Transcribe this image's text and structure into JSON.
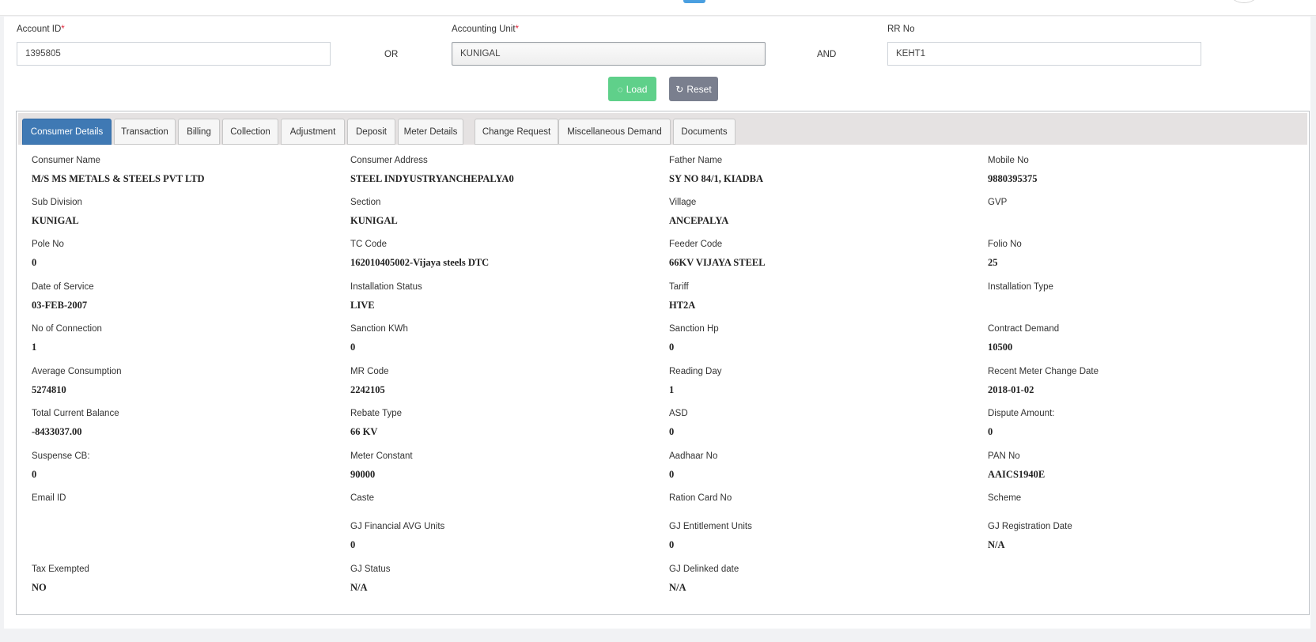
{
  "search": {
    "account_id_label": "Account ID",
    "account_id_value": "1395805",
    "or_label": "OR",
    "accounting_unit_label": "Accounting Unit",
    "accounting_unit_value": "KUNIGAL",
    "and_label": "AND",
    "rr_no_label": "RR No",
    "rr_no_value": "KEHT1",
    "required_mark": "*",
    "load_label": "Load",
    "reset_label": "Reset"
  },
  "tabs": [
    {
      "label": "Consumer Details",
      "active": true
    },
    {
      "label": "Transaction"
    },
    {
      "label": "Billing"
    },
    {
      "label": "Collection"
    },
    {
      "label": "Adjustment"
    },
    {
      "label": "Deposit"
    },
    {
      "label": "Meter Details"
    },
    {
      "label": "Change Request"
    },
    {
      "label": "Miscellaneous Demand"
    },
    {
      "label": "Documents"
    }
  ],
  "details": [
    [
      {
        "label": "Consumer Name",
        "value": "M/S MS METALS & STEELS PVT LTD"
      },
      {
        "label": "Consumer Address",
        "value": "STEEL INDYUSTRYANCHEPALYA0"
      },
      {
        "label": "Father Name",
        "value": "SY NO 84/1, KIADBA"
      },
      {
        "label": "Mobile No",
        "value": "9880395375"
      }
    ],
    [
      {
        "label": "Sub Division",
        "value": "KUNIGAL"
      },
      {
        "label": "Section",
        "value": "KUNIGAL"
      },
      {
        "label": "Village",
        "value": "ANCEPALYA"
      },
      {
        "label": "GVP",
        "value": ""
      }
    ],
    [
      {
        "label": "Pole No",
        "value": "0"
      },
      {
        "label": "TC Code",
        "value": "162010405002-Vijaya steels DTC"
      },
      {
        "label": "Feeder Code",
        "value": "66KV VIJAYA STEEL"
      },
      {
        "label": "Folio No",
        "value": "25"
      }
    ],
    [
      {
        "label": "Date of Service",
        "value": "03-FEB-2007"
      },
      {
        "label": "Installation Status",
        "value": "LIVE"
      },
      {
        "label": "Tariff",
        "value": "HT2A"
      },
      {
        "label": "Installation Type",
        "value": ""
      }
    ],
    [
      {
        "label": "No of Connection",
        "value": "1"
      },
      {
        "label": "Sanction KWh",
        "value": "0"
      },
      {
        "label": "Sanction Hp",
        "value": "0"
      },
      {
        "label": "Contract Demand",
        "value": "10500"
      }
    ],
    [
      {
        "label": "Average Consumption",
        "value": "5274810"
      },
      {
        "label": "MR Code",
        "value": "2242105"
      },
      {
        "label": "Reading Day",
        "value": "1"
      },
      {
        "label": "Recent Meter Change Date",
        "value": "2018-01-02"
      }
    ],
    [
      {
        "label": "Total Current Balance",
        "value": "-8433037.00"
      },
      {
        "label": "Rebate Type",
        "value": "66 KV"
      },
      {
        "label": "ASD",
        "value": "0"
      },
      {
        "label": "Dispute Amount:",
        "value": "0"
      }
    ],
    [
      {
        "label": "Suspense CB:",
        "value": "0"
      },
      {
        "label": "Meter Constant",
        "value": "90000"
      },
      {
        "label": "Aadhaar No",
        "value": "0"
      },
      {
        "label": "PAN No",
        "value": "AAICS1940E"
      }
    ],
    [
      {
        "label": "Email ID",
        "value": ""
      },
      {
        "label": "Caste",
        "value": ""
      },
      {
        "label": "Ration Card No",
        "value": ""
      },
      {
        "label": "Scheme",
        "value": ""
      }
    ],
    [
      null,
      {
        "label": "GJ Financial AVG Units",
        "value": "0"
      },
      {
        "label": "GJ Entitlement Units",
        "value": "0"
      },
      {
        "label": "GJ Registration Date",
        "value": "N/A"
      }
    ],
    [
      {
        "label": "Tax Exempted",
        "value": "NO"
      },
      {
        "label": "GJ Status",
        "value": "N/A"
      },
      {
        "label": "GJ Delinked date",
        "value": "N/A"
      },
      null
    ]
  ],
  "colors": {
    "active_tab": "#3f79b4",
    "load_button": "#5fd08a",
    "reset_button": "#7a7f8e",
    "required": "#e0263b"
  }
}
